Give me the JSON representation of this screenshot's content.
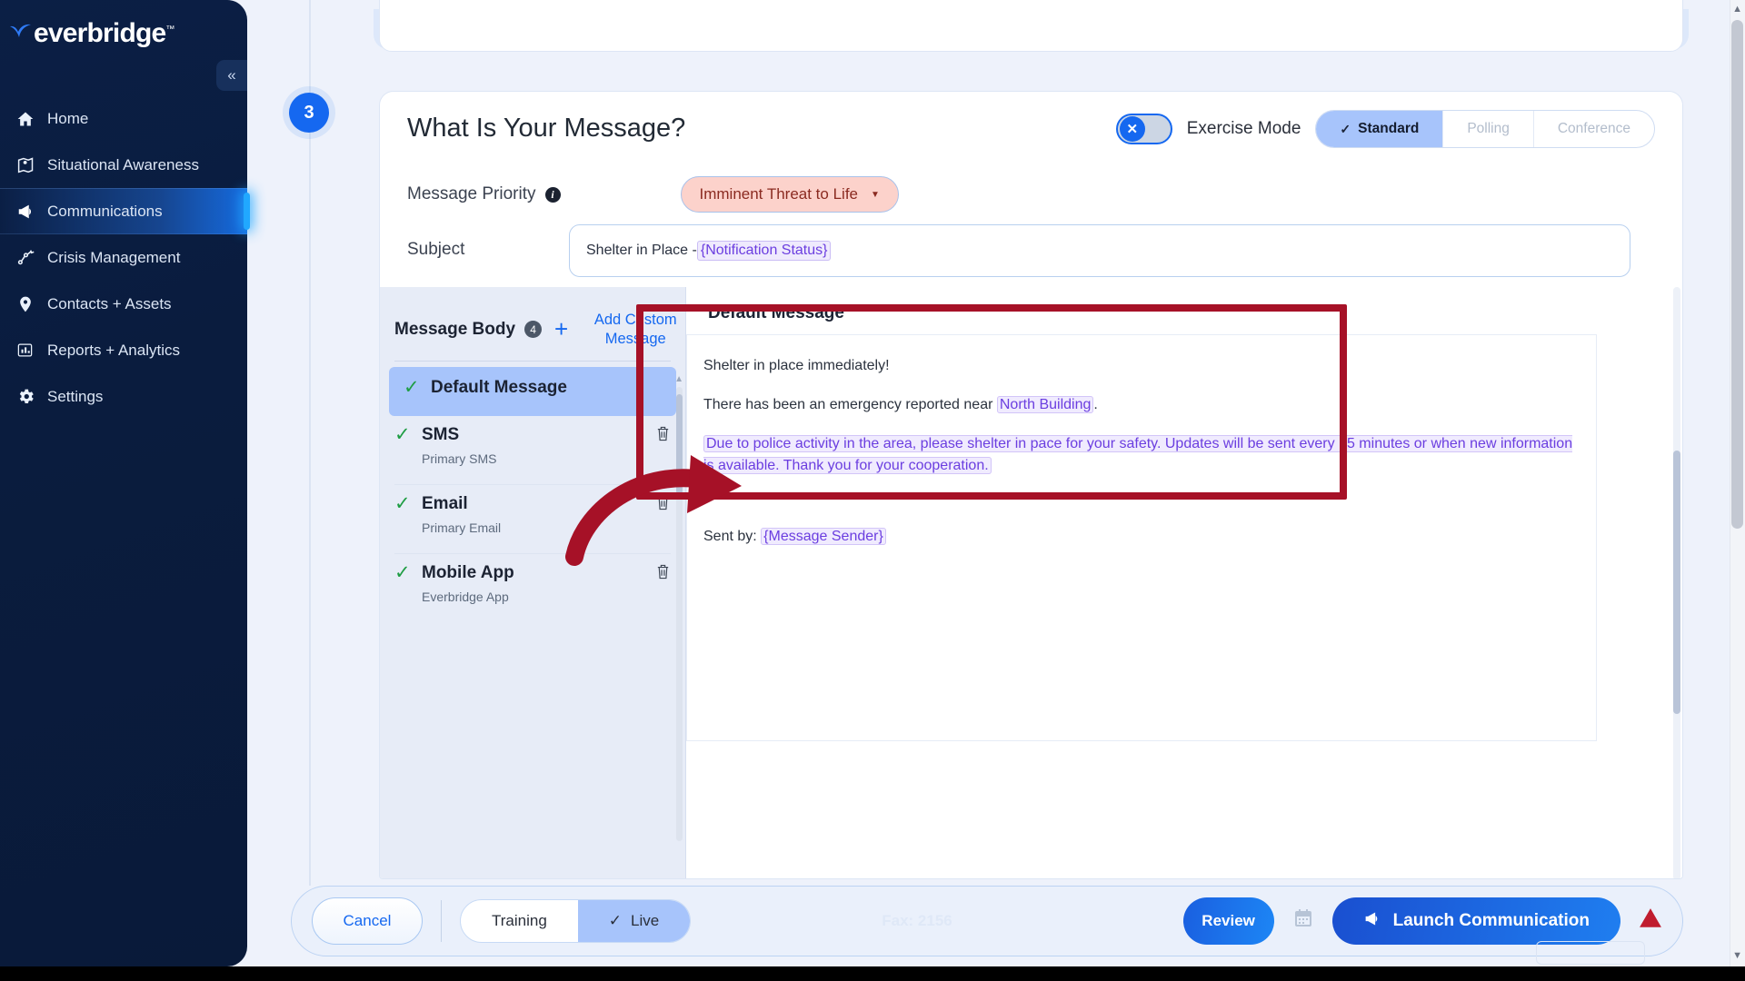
{
  "brand": {
    "name": "everbridge",
    "tm": "™",
    "accent": "#1568f0"
  },
  "sidebar": {
    "collapse_icon": "«",
    "items": [
      {
        "label": "Home",
        "icon": "home-icon",
        "active": false
      },
      {
        "label": "Situational Awareness",
        "icon": "map-pin-icon",
        "active": false
      },
      {
        "label": "Communications",
        "icon": "megaphone-icon",
        "active": true
      },
      {
        "label": "Crisis Management",
        "icon": "network-icon",
        "active": false
      },
      {
        "label": "Contacts + Assets",
        "icon": "location-icon",
        "active": false
      },
      {
        "label": "Reports + Analytics",
        "icon": "bar-chart-icon",
        "active": false
      },
      {
        "label": "Settings",
        "icon": "gear-icon",
        "active": false
      }
    ]
  },
  "step": {
    "number": "3"
  },
  "card": {
    "title": "What Is Your Message?",
    "exercise_mode": {
      "label": "Exercise Mode",
      "enabled": false,
      "knob_glyph": "✕"
    },
    "mode_tabs": [
      {
        "label": "Standard",
        "selected": true,
        "tick": "✓"
      },
      {
        "label": "Polling",
        "selected": false,
        "tick": ""
      },
      {
        "label": "Conference",
        "selected": false,
        "tick": ""
      }
    ],
    "priority": {
      "label": "Message Priority",
      "info_glyph": "i",
      "value": "Imminent Threat to Life",
      "caret": "▼",
      "pill_bg": "#fcd2cb",
      "pill_text_color": "#8a2a20"
    },
    "subject": {
      "label": "Subject",
      "value_prefix": "Shelter in Place - ",
      "value_token": "{Notification Status}"
    }
  },
  "message_body": {
    "title": "Message Body",
    "count": "4",
    "plus_glyph": "+",
    "add_custom_label": "Add Custom Message",
    "items": [
      {
        "name": "Default Message",
        "sub": "",
        "selected": true,
        "checked": true,
        "deletable": false
      },
      {
        "name": "SMS",
        "sub": "Primary SMS",
        "selected": false,
        "checked": true,
        "deletable": true
      },
      {
        "name": "Email",
        "sub": "Primary Email",
        "selected": false,
        "checked": true,
        "deletable": true
      },
      {
        "name": "Mobile App",
        "sub": "Everbridge App",
        "selected": false,
        "checked": true,
        "deletable": true
      }
    ],
    "check_glyph": "✓",
    "trash_glyph": "🗑"
  },
  "editor": {
    "title": "Default Message",
    "line1": "Shelter in place immediately!",
    "line2_prefix": "There has been an emergency reported near ",
    "line2_token": "North Building",
    "line2_suffix": ".",
    "line3_highlight": "Due to police activity in the area, please shelter in pace for your safety. Updates will be sent every 15 minutes or when new information is available. Thank you for your cooperation.",
    "line4": ".",
    "line5_prefix": "Sent by: ",
    "line5_token": "{Message Sender}",
    "highlight_border_color": "#a61127"
  },
  "bottom_bar": {
    "cancel_label": "Cancel",
    "env_tabs": [
      {
        "label": "Training",
        "selected": false,
        "tick": ""
      },
      {
        "label": "Live",
        "selected": true,
        "tick": "✓"
      }
    ],
    "fax_note": "Fax: 2156",
    "review_label": "Review",
    "calendar_icon": "🗓",
    "launch_label": "Launch Communication",
    "launch_icon": "megaphone-icon",
    "warning_icon": "⚠"
  },
  "scrollbar": {
    "up_arrow": "▲",
    "down_arrow": "▼"
  }
}
